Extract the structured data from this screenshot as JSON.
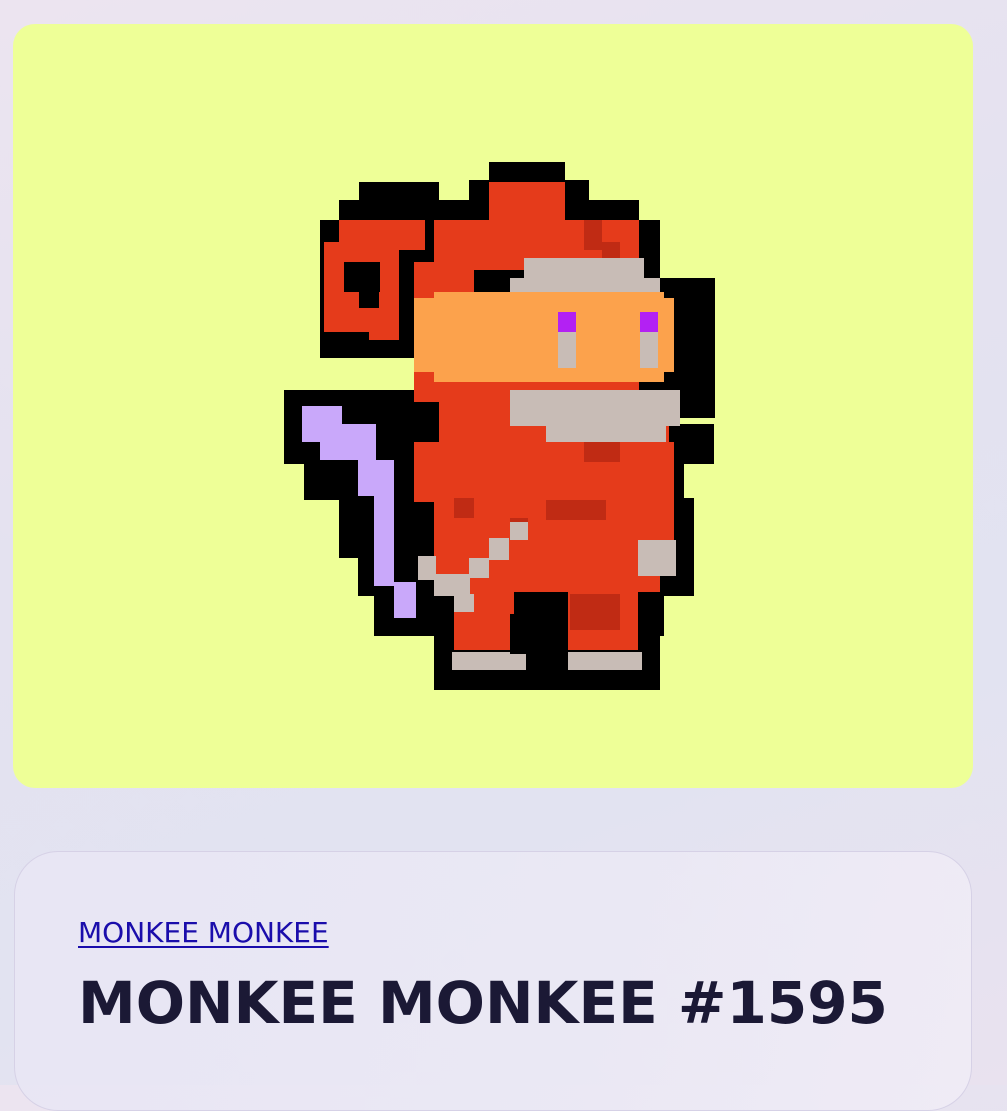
{
  "nft": {
    "collection_name": "MONKEE MONKEE",
    "title": "MONKEE MONKEE #1595",
    "image_background": "#eeff97",
    "image_icon": "pixel-monkey-icon"
  },
  "colors": {
    "outline": "#000000",
    "fur_red": "#e53b1b",
    "fur_dark_red": "#c02b14",
    "face_orange": "#fca24c",
    "mask_gray": "#c8bcb6",
    "eye_purple": "#b321f3",
    "tail_lavender": "#c9a8fa",
    "title_text": "#1b1935",
    "link_text": "#1a0dab"
  }
}
